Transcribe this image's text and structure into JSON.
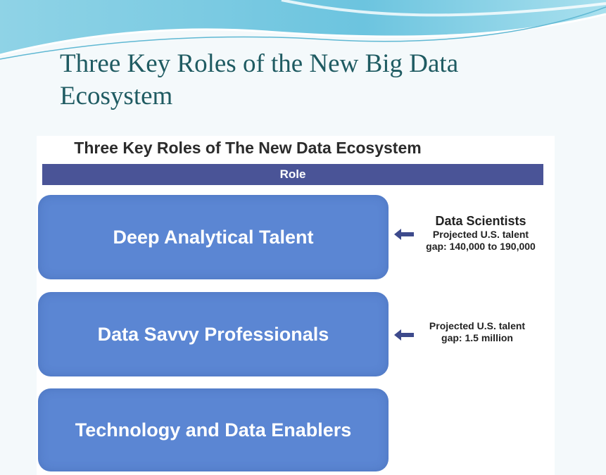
{
  "slide": {
    "title": "Three Key Roles of the New Big Data Ecosystem"
  },
  "figure": {
    "title": "Three Key Roles of The New Data Ecosystem",
    "header": "Role",
    "roles": [
      {
        "label": "Deep Analytical Talent",
        "note_heading": "Data Scientists",
        "note_lines": [
          "Projected U.S. talent",
          "gap: 140,000 to 190,000"
        ]
      },
      {
        "label": "Data Savvy Professionals",
        "note_lines": [
          "Projected U.S. talent",
          "gap: 1.5 million"
        ]
      },
      {
        "label": "Technology and Data Enablers"
      }
    ]
  },
  "colors": {
    "title_teal": "#1f5b62",
    "role_bar": "#4a5497",
    "role_box": "#5b86d3",
    "arrow": "#3d4a8c"
  },
  "icons": [
    "wave-decoration",
    "left-arrow-icon"
  ]
}
